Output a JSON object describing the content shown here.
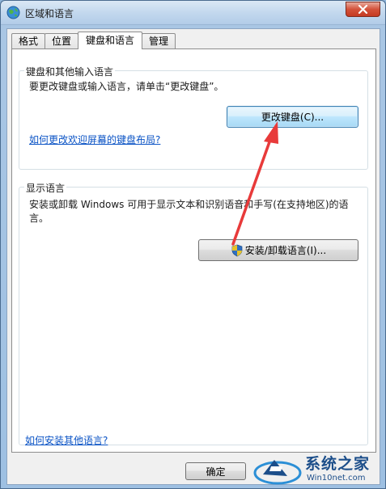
{
  "window": {
    "title": "区域和语言",
    "icon": "globe-icon",
    "close_icon": "close-icon"
  },
  "tabs": [
    {
      "label": "格式",
      "active": false
    },
    {
      "label": "位置",
      "active": false
    },
    {
      "label": "键盘和语言",
      "active": true
    },
    {
      "label": "管理",
      "active": false
    }
  ],
  "keyboard_group": {
    "title": "键盘和其他输入语言",
    "description": "要更改键盘或输入语言，请单击“更改键盘”。",
    "change_button": "更改键盘(C)...",
    "welcome_link": "如何更改欢迎屏幕的键盘布局?"
  },
  "display_group": {
    "title": "显示语言",
    "description_line1": "安装或卸载 Windows 可用于显示文本和识别语音和手写(在支持地区)的语",
    "description_line2": "言。",
    "install_button": "安装/卸载语言(I)...",
    "install_icon": "uac-shield-icon"
  },
  "footer": {
    "link": "如何安装其他语言?",
    "ok_button": "确定"
  },
  "watermark": {
    "title": "系统之家",
    "url": "Win10net.com"
  },
  "colors": {
    "accent": "#3c7fb1",
    "link": "#0a53c5",
    "annotation_arrow": "#e83a3a"
  }
}
